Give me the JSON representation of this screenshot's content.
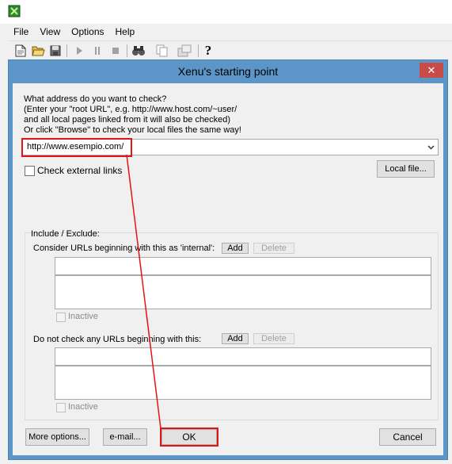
{
  "menu": [
    "File",
    "View",
    "Options",
    "Help"
  ],
  "toolbar": {
    "icons": [
      "new-file-icon",
      "open-folder-icon",
      "save-icon",
      "play-icon",
      "pause-icon",
      "stop-icon",
      "binoculars-icon",
      "copy-icon",
      "properties-icon",
      "help-icon"
    ],
    "help_glyph": "?"
  },
  "dialog": {
    "title": "Xenu's starting point",
    "close_glyph": "✕",
    "instructions": [
      "What address do you want to check?",
      "(Enter your \"root URL\", e.g. http://www.host.com/~user/",
      "and all local pages linked from it will also be checked)",
      "Or click \"Browse\" to check your local files the same way!"
    ],
    "url_value": "http://www.esempio.com/",
    "check_external_label": "Check external links",
    "check_external_checked": false,
    "local_file_button": "Local file...",
    "include_exclude_label": "Include / Exclude:",
    "internal_label": "Consider URLs beginning with this as 'internal':",
    "add_label": "Add",
    "delete_label": "Delete",
    "inactive_label": "Inactive",
    "do_not_check_label": "Do not check any URLs beginning with this:",
    "more_options_button": "More options...",
    "email_button": "e-mail...",
    "ok_button": "OK",
    "cancel_button": "Cancel"
  },
  "colors": {
    "dialog_title_bar": "#5c96c9",
    "close_button": "#c74b48",
    "annotation_red": "#e01515"
  }
}
